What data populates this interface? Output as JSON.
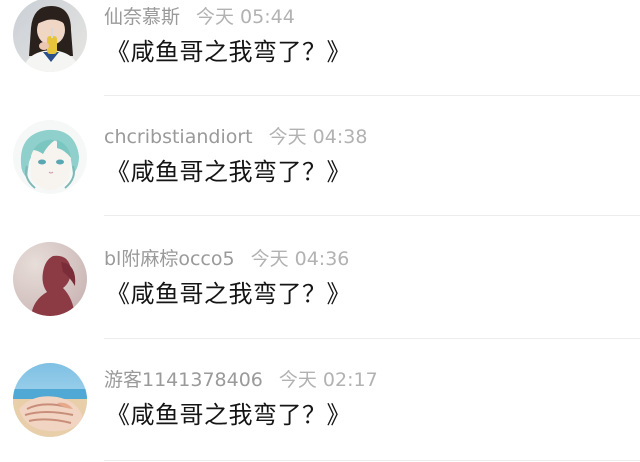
{
  "comments": [
    {
      "username": "仙奈慕斯",
      "time": "今天 05:44",
      "text": "《咸鱼哥之我弯了？》",
      "avatar": "girl-with-drink-avatar"
    },
    {
      "username": "chcribstiandiort",
      "time": "今天 04:38",
      "text": "《咸鱼哥之我弯了？》",
      "avatar": "anime-character-avatar"
    },
    {
      "username": "bl附麻棕occo5",
      "time": "今天 04:36",
      "text": "《咸鱼哥之我弯了？》",
      "avatar": "silhouette-avatar"
    },
    {
      "username": "游客1141378406",
      "time": "今天 02:17",
      "text": "《咸鱼哥之我弯了？》",
      "avatar": "seashell-beach-avatar"
    }
  ]
}
